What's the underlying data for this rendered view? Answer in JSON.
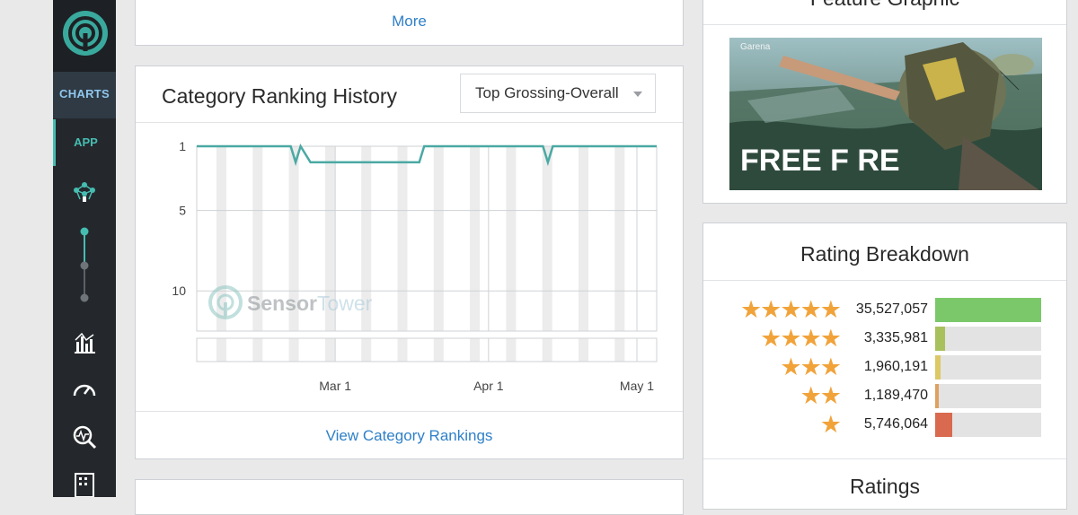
{
  "sidebar": {
    "charts_label": "CHARTS",
    "app_label": "APP"
  },
  "top_card": {
    "more_link": "More"
  },
  "ranking_card": {
    "title": "Category Ranking History",
    "dropdown_value": "Top Grossing-Overall",
    "footer_link": "View Category Rankings",
    "watermark_a": "Sensor",
    "watermark_b": "Tower"
  },
  "chart_data": {
    "type": "line",
    "title": "Category Ranking History",
    "y_ticks": [
      "1",
      "5",
      "10"
    ],
    "y_axis_inverted": true,
    "x_ticks": [
      "Mar 1",
      "Apr 1",
      "May 1"
    ],
    "series": [
      {
        "values": [
          {
            "x": "Feb 1",
            "y": 1
          },
          {
            "x": "Feb 20",
            "y": 1
          },
          {
            "x": "Feb 21",
            "y": 2
          },
          {
            "x": "Feb 22",
            "y": 1
          },
          {
            "x": "Feb 24",
            "y": 2
          },
          {
            "x": "Mar 18",
            "y": 2
          },
          {
            "x": "Mar 19",
            "y": 1
          },
          {
            "x": "Apr 12",
            "y": 1
          },
          {
            "x": "Apr 13",
            "y": 2
          },
          {
            "x": "Apr 14",
            "y": 1
          },
          {
            "x": "May 5",
            "y": 1
          }
        ]
      }
    ],
    "color": "#4aa9a3"
  },
  "feature_card": {
    "title": "Feature Graphic",
    "brand": "Garena",
    "game_title": "FREE F RE"
  },
  "rating_card": {
    "title": "Rating Breakdown",
    "rows": [
      {
        "stars": "★★★★★",
        "count": "35,527,057",
        "fraction": 1.0,
        "color": "#7bc86a"
      },
      {
        "stars": "★★★★",
        "count": "3,335,981",
        "fraction": 0.094,
        "color": "#a8c15c"
      },
      {
        "stars": "★★★",
        "count": "1,960,191",
        "fraction": 0.055,
        "color": "#dcc865"
      },
      {
        "stars": "★★",
        "count": "1,189,470",
        "fraction": 0.034,
        "color": "#dea160"
      },
      {
        "stars": "★",
        "count": "5,746,064",
        "fraction": 0.162,
        "color": "#d96a4f"
      }
    ],
    "next_title": "Ratings"
  }
}
